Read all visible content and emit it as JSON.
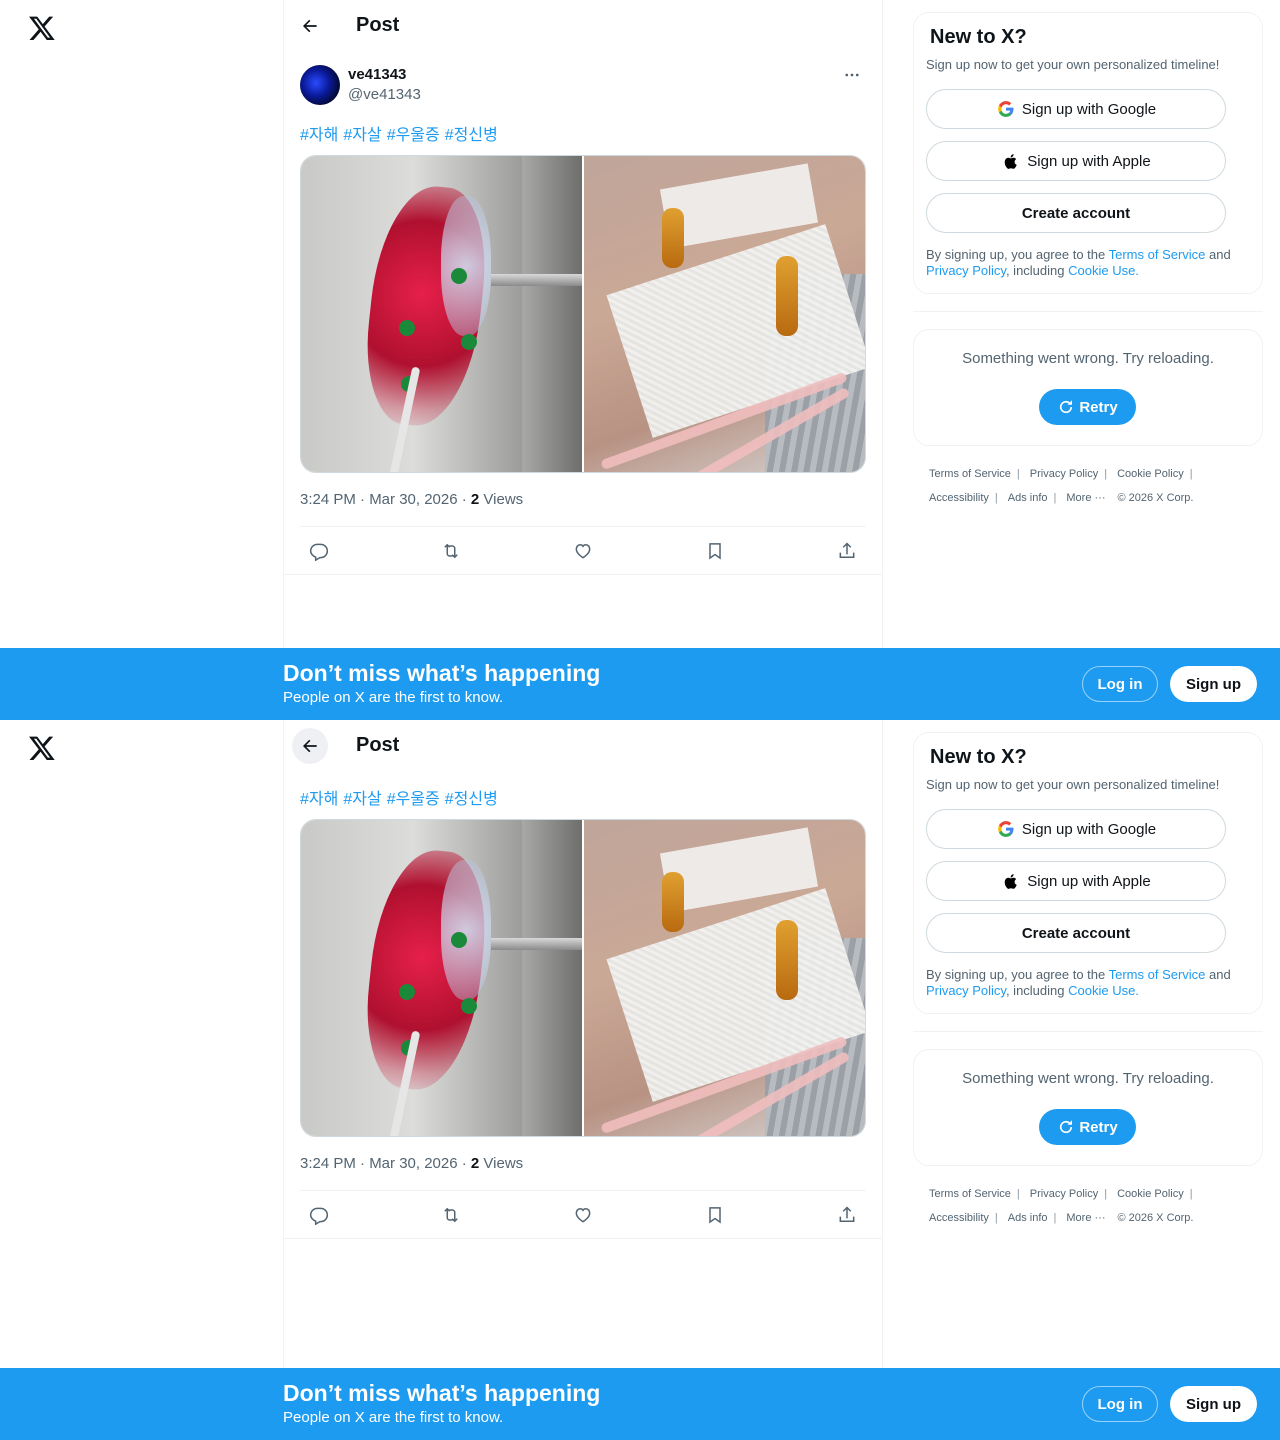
{
  "page": {
    "title": "Post",
    "author": {
      "name": "ve41343",
      "handle": "@ve41343"
    },
    "hashtags": [
      "#자해",
      "#자살",
      "#우울증",
      "#정신병"
    ],
    "timestamp": "3:24 PM · Mar 30, 2026 · ",
    "views_count": "2",
    "views_label": " Views",
    "actions": [
      "reply-icon",
      "repost-icon",
      "like-icon",
      "bookmark-icon",
      "share-icon"
    ]
  },
  "sidebar": {
    "title": "New to X?",
    "subtitle": "Sign up now to get your own personalized timeline!",
    "google": "Sign up with Google",
    "apple": "Sign up with Apple",
    "create": "Create account",
    "legal_prefix": "By signing up, you agree to the ",
    "terms": "Terms of Service",
    "and": " and ",
    "privacy": "Privacy Policy",
    "including": ", including ",
    "cookie": "Cookie Use.",
    "error_text": "Something went wrong. Try reloading.",
    "retry": "Retry"
  },
  "footer": {
    "terms": "Terms of Service",
    "privacy": "Privacy Policy",
    "cookie": "Cookie Policy",
    "accessibility": "Accessibility",
    "ads": "Ads info",
    "more": "More ···",
    "copyright": "© 2026 X Corp.",
    "separator": "|"
  },
  "banner": {
    "title": "Don’t miss what’s happening",
    "subtitle": "People on X are the first to know.",
    "login": "Log in",
    "signup": "Sign up"
  },
  "colors": {
    "accent": "#1d9bf0",
    "text": "#0f1419",
    "muted": "#536471",
    "border": "#eff3f4"
  }
}
